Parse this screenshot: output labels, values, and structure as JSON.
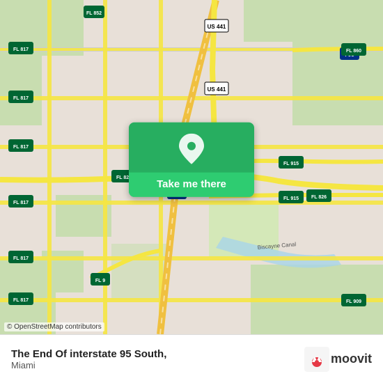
{
  "map": {
    "attribution": "© OpenStreetMap contributors"
  },
  "button": {
    "label": "Take me there",
    "icon": "location-pin-icon"
  },
  "location": {
    "title": "The End Of interstate 95 South,",
    "subtitle": "Miami"
  },
  "branding": {
    "name": "moovit"
  }
}
